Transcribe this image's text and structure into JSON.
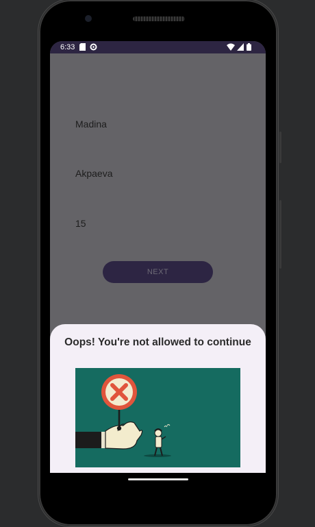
{
  "status_bar": {
    "time": "6:33",
    "icons_left": [
      "sd-card-icon",
      "settings-icon"
    ],
    "icons_right": [
      "wifi-icon",
      "signal-icon",
      "battery-icon"
    ]
  },
  "form": {
    "first_name": "Madina",
    "last_name": "Akpaeva",
    "age": "15",
    "next_label": "NEXT"
  },
  "bottom_sheet": {
    "title": "Oops! You're not allowed to continue",
    "illustration": "hand-holding-stop-sign-illustration"
  },
  "colors": {
    "status_bar": "#2d2542",
    "scrim": "#646367",
    "button": "#2d2543",
    "sheet": "#f4eff7",
    "illustration_bg": "#156b60",
    "sign_red": "#e0553c"
  }
}
